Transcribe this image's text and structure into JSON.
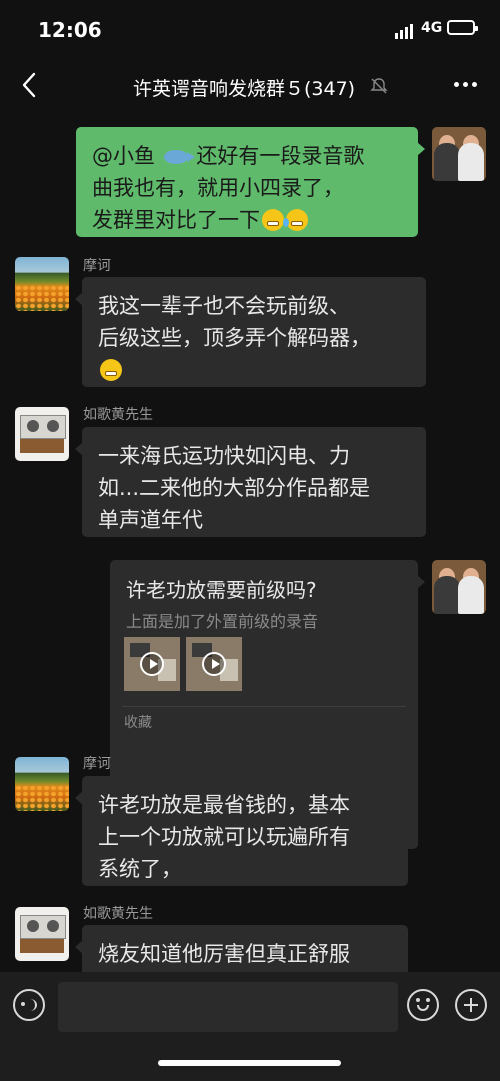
{
  "status_bar": {
    "time": "12:06",
    "network": "4G"
  },
  "header": {
    "title": "许英谔音响发烧群５(347)"
  },
  "messages": [
    {
      "sender": "",
      "line1": "@小鱼",
      "line1b": "还好有一段录音歌",
      "line2": "曲我也有，就用小四录了，",
      "line3": "发群里对比了一下"
    },
    {
      "sender": "摩诃",
      "line1": "我这一辈子也不会玩前级、",
      "line2": "后级这些，顶多弄个解码器，"
    },
    {
      "sender": "如歌黄先生",
      "line1": "一来海氏运功快如闪电、力",
      "line2": "如...二来他的大部分作品都是",
      "line3": "单声道年代"
    },
    {
      "sender": "摩诃",
      "line1": "许老功放是最省钱的，基本",
      "line2": "上一个功放就可以玩遍所有",
      "line3": "系统了，"
    },
    {
      "sender": "如歌黄先生",
      "line1": "烧友知道他厉害但真正舒服"
    }
  ],
  "favorite_card": {
    "title": "许老功放需要前级吗?",
    "subtitle": "上面是加了外置前级的录音",
    "footer": "收藏"
  },
  "input": {
    "placeholder": ""
  },
  "icons": {
    "back": "chevron-left-icon",
    "mute": "bell-off-icon",
    "more": "more-dots-icon",
    "voice": "voice-icon",
    "emoji": "smiley-icon",
    "plus": "plus-icon"
  }
}
